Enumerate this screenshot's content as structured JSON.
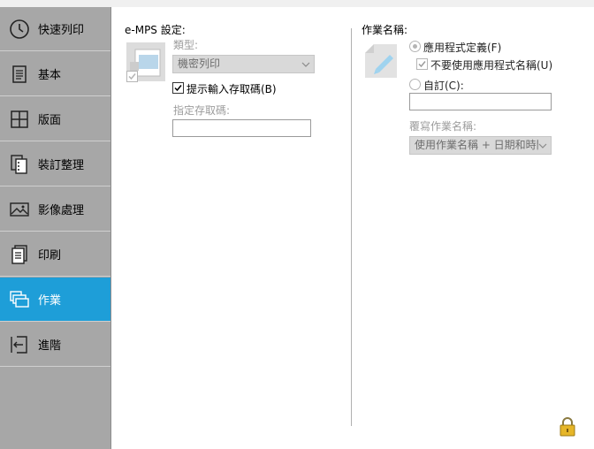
{
  "sidebar": {
    "items": [
      {
        "label": "快速列印",
        "icon": "clock-icon",
        "active": false
      },
      {
        "label": "基本",
        "icon": "document-icon",
        "active": false
      },
      {
        "label": "版面",
        "icon": "layout-grid-icon",
        "active": false
      },
      {
        "label": "裝訂整理",
        "icon": "staple-document-icon",
        "active": false
      },
      {
        "label": "影像處理",
        "icon": "image-icon",
        "active": false
      },
      {
        "label": "印刷",
        "icon": "print-document-icon",
        "active": false
      },
      {
        "label": "作業",
        "icon": "job-folders-icon",
        "active": true
      },
      {
        "label": "進階",
        "icon": "advanced-exit-icon",
        "active": false
      }
    ],
    "active_color": "#1e9ed8",
    "background": "#a7a7a7"
  },
  "emps": {
    "title": "e-MPS 設定:",
    "icon": "secure-print-icon",
    "type_label": "類型:",
    "type_value": "機密列印",
    "show_code_label": "提示輸入存取碼(B)",
    "show_code_checked": true,
    "access_code_label": "指定存取碼:",
    "access_code_value": ""
  },
  "jobname": {
    "title": "作業名稱:",
    "icon": "pencil-document-icon",
    "app_defined_label": "應用程式定義(F)",
    "no_app_name_label": "不要使用應用程式名稱(U)",
    "custom_label": "自訂(C):",
    "custom_value": "",
    "overwrite_label": "覆寫作業名稱:",
    "overwrite_value": "使用作業名稱 + 日期和時間"
  },
  "footer": {
    "lock_icon": "lock-icon"
  }
}
